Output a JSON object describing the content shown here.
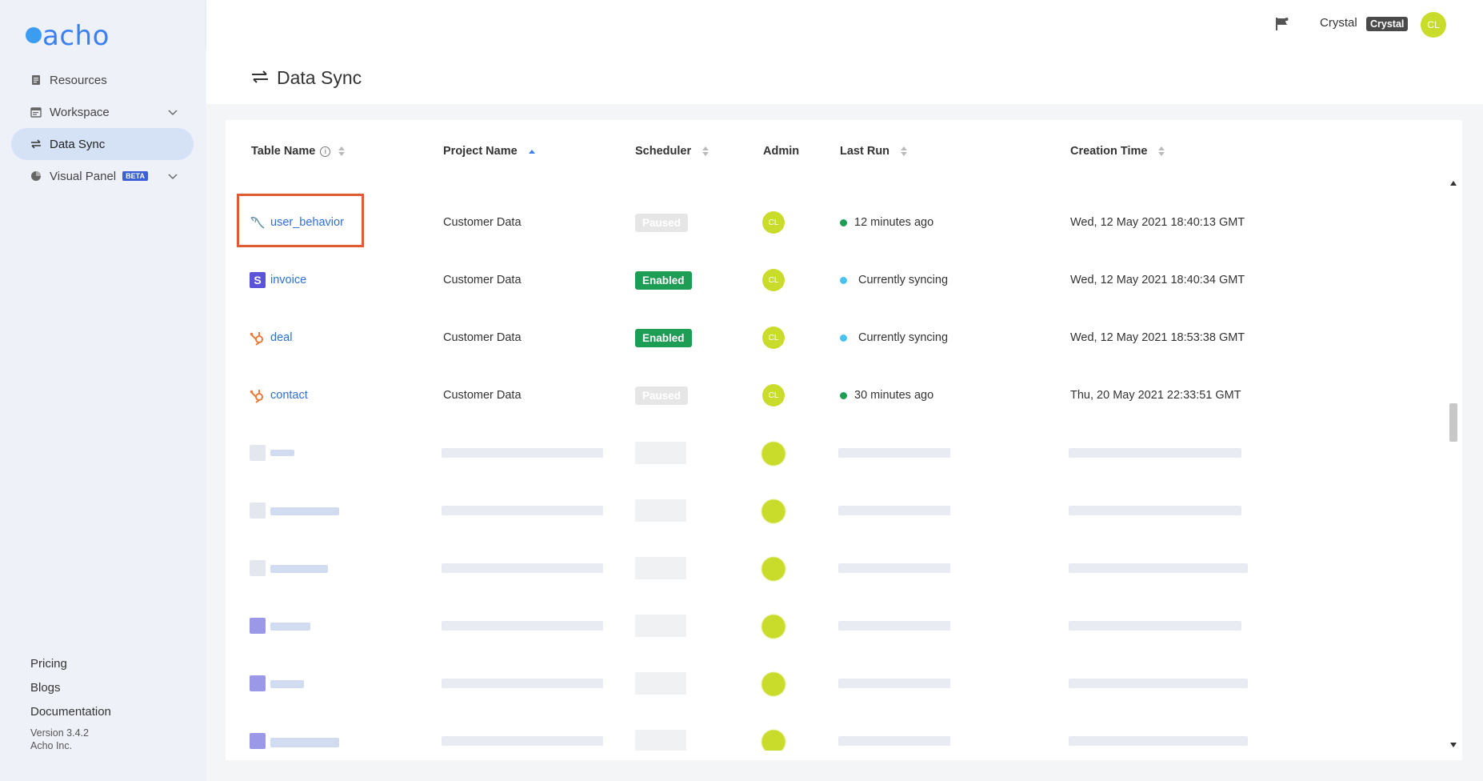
{
  "app": {
    "logo_text": "acho"
  },
  "sidebar": {
    "items": [
      {
        "label": "Resources",
        "icon": "document-icon"
      },
      {
        "label": "Workspace",
        "icon": "workspace-icon",
        "expandable": true
      },
      {
        "label": "Data Sync",
        "icon": "swap-icon",
        "active": true
      },
      {
        "label": "Visual Panel",
        "icon": "pie-chart-icon",
        "badge": "BETA",
        "expandable": true
      }
    ],
    "footer_links": [
      "Pricing",
      "Blogs",
      "Documentation"
    ],
    "version": "Version 3.4.2",
    "company": "Acho Inc."
  },
  "header": {
    "user_name": "Crystal",
    "user_badge": "Crystal",
    "user_initials": "CL"
  },
  "page": {
    "title": "Data Sync"
  },
  "table": {
    "columns": [
      {
        "label": "Table Name",
        "info": "i",
        "sort": "none"
      },
      {
        "label": "Project Name",
        "sort": "asc"
      },
      {
        "label": "Scheduler",
        "sort": "none"
      },
      {
        "label": "Admin"
      },
      {
        "label": "Last Run",
        "sort": "none"
      },
      {
        "label": "Creation Time",
        "sort": "none"
      }
    ],
    "rows": [
      {
        "name": "user_behavior",
        "source_icon": "mysql-dolphin-icon",
        "project": "Customer Data",
        "scheduler": "Paused",
        "admin": "CL",
        "last_run": "12 minutes ago",
        "status": "done",
        "created": "Wed, 12 May 2021 18:40:13 GMT"
      },
      {
        "name": "invoice",
        "source_icon": "stripe-icon",
        "project": "Customer Data",
        "scheduler": "Enabled",
        "admin": "CL",
        "last_run": "Currently syncing",
        "status": "syncing",
        "created": "Wed, 12 May 2021 18:40:34 GMT"
      },
      {
        "name": "deal",
        "source_icon": "hubspot-icon",
        "project": "Customer Data",
        "scheduler": "Enabled",
        "admin": "CL",
        "last_run": "Currently syncing",
        "status": "syncing",
        "created": "Wed, 12 May 2021 18:53:38 GMT"
      },
      {
        "name": "contact",
        "source_icon": "hubspot-icon",
        "project": "Customer Data",
        "scheduler": "Paused",
        "admin": "CL",
        "last_run": "30 minutes ago",
        "status": "done",
        "created": "Thu, 20 May 2021 22:33:51 GMT"
      }
    ]
  },
  "colors": {
    "accent": "#3b7ff0",
    "enabled": "#1e9d55",
    "paused": "#e6e6e6",
    "avatar": "#c9dc2c",
    "syncing_dot": "#48c2ee",
    "highlight_box": "#e05a32"
  }
}
